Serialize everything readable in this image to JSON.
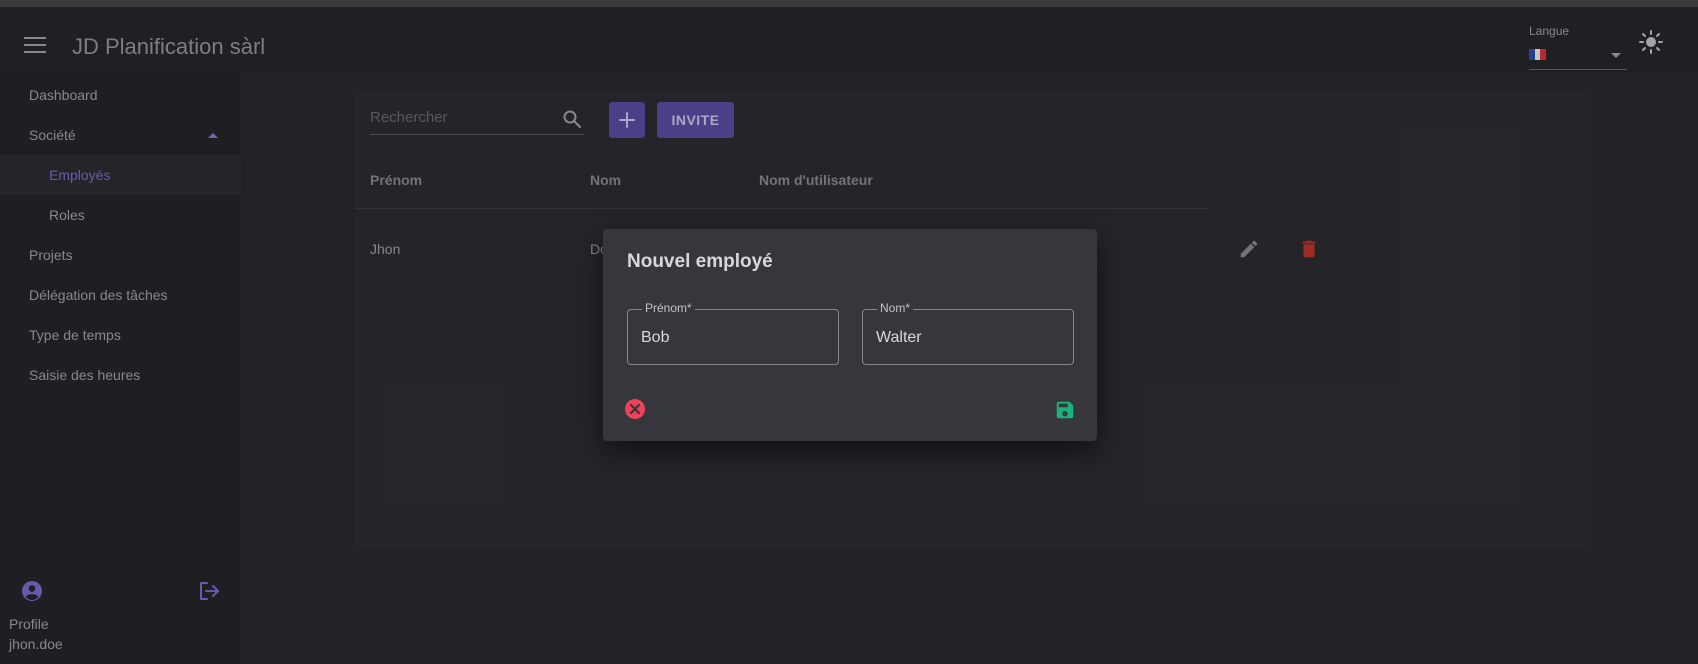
{
  "app": {
    "title": "JD Planification sàrl"
  },
  "header": {
    "language_label": "Langue",
    "language_flag": "french-flag",
    "theme_icon": "sun-icon"
  },
  "sidebar": {
    "items": [
      {
        "label": "Dashboard"
      },
      {
        "label": "Société",
        "expanded": true
      },
      {
        "label": "Employés",
        "active": true
      },
      {
        "label": "Roles"
      },
      {
        "label": "Projets"
      },
      {
        "label": "Délégation des tâches"
      },
      {
        "label": "Type de temps"
      },
      {
        "label": "Saisie des heures"
      }
    ],
    "footer": {
      "profile_label": "Profile",
      "username": "jhon.doe"
    }
  },
  "toolbar": {
    "search_placeholder": "Rechercher",
    "add_icon": "plus-icon",
    "invite_label": "INVITE"
  },
  "table": {
    "columns": [
      "Prénom",
      "Nom",
      "Nom d'utilisateur"
    ],
    "rows": [
      {
        "prenom": "Jhon",
        "nom": "Do"
      }
    ]
  },
  "dialog": {
    "title": "Nouvel employé",
    "first_name_label": "Prénom*",
    "first_name_value": "Bob",
    "last_name_label": "Nom*",
    "last_name_value": "Walter",
    "cancel_icon": "close-circle-icon",
    "save_icon": "save-icon"
  },
  "colors": {
    "accent": "#5c4fa6",
    "active_text": "#7c6fd2",
    "delete": "#c0392b",
    "cancel": "#f0435a",
    "save": "#17b37a"
  }
}
